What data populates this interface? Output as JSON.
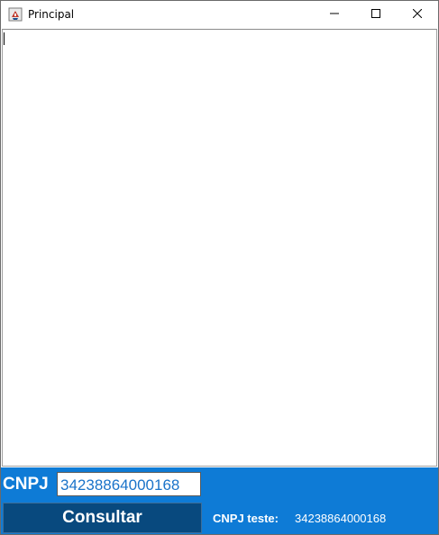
{
  "window": {
    "title": "Principal",
    "icon": "java-coffee-icon"
  },
  "titlebar_buttons": {
    "minimize_icon": "minimize-icon",
    "maximize_icon": "maximize-icon",
    "close_icon": "close-icon"
  },
  "form": {
    "cnpj_label": "CNPJ",
    "cnpj_value": "34238864000168",
    "consultar_label": "Consultar",
    "teste_label": "CNPJ teste:",
    "teste_value": "34238864000168"
  },
  "colors": {
    "panel_bg": "#0e7bd6",
    "button_bg": "#08497e",
    "input_text": "#1a73c9"
  }
}
